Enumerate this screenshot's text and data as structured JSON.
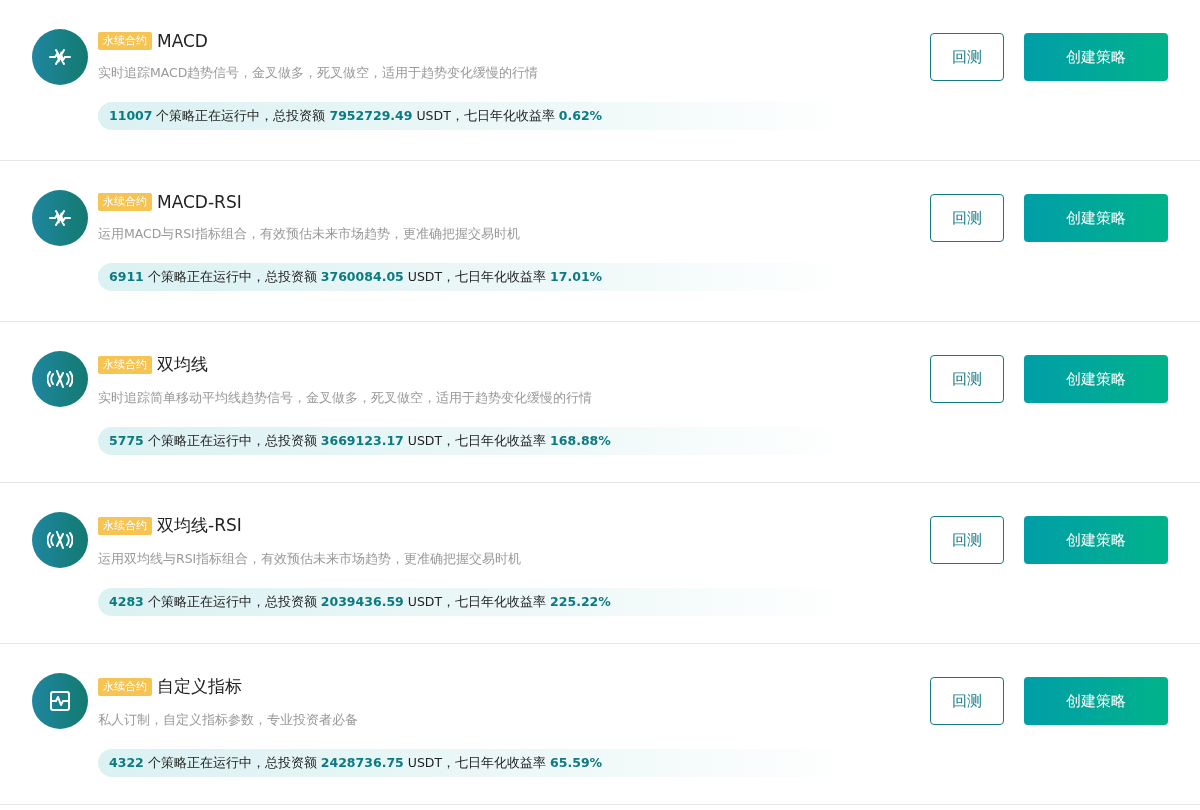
{
  "strategies": [
    {
      "kind": "signal",
      "tag": "永续合约",
      "title": "MACD",
      "description": "实时追踪MACD趋势信号，金叉做多，死叉做空，适用于趋势变化缓慢的行情",
      "stats": "**11007** 个策略正在运行中，总投资额 **7952729.49** USDT，七日年化收益率 **0.62%**",
      "backtest": "回测",
      "create": "创建策略"
    },
    {
      "kind": "signal",
      "tag": "永续合约",
      "title": "MACD-RSI",
      "description": "运用MACD与RSI指标组合，有效预估未来市场趋势，更准确把握交易时机",
      "stats": "**6911** 个策略正在运行中，总投资额 **3760084.05** USDT，七日年化收益率 **17.01%**",
      "backtest": "回测",
      "create": "创建策略"
    },
    {
      "kind": "wave",
      "tag": "永续合约",
      "title": "双均线",
      "description": "实时追踪简单移动平均线趋势信号，金叉做多，死叉做空，适用于趋势变化缓慢的行情",
      "stats": "**5775** 个策略正在运行中，总投资额 **3669123.17** USDT，七日年化收益率 **168.88%**",
      "backtest": "回测",
      "create": "创建策略"
    },
    {
      "kind": "wave",
      "tag": "永续合约",
      "title": "双均线-RSI",
      "description": "运用双均线与RSI指标组合，有效预估未来市场趋势，更准确把握交易时机",
      "stats": "**4283** 个策略正在运行中，总投资额 **2039436.59** USDT，七日年化收益率 **225.22%**",
      "backtest": "回测",
      "create": "创建策略"
    },
    {
      "kind": "chart",
      "tag": "永续合约",
      "title": "自定义指标",
      "description": "私人订制，自定义指标参数，专业投资者必备",
      "stats": "**4322** 个策略正在运行中，总投资额 **2428736.75** USDT，七日年化收益率 **65.59%**",
      "backtest": "回测",
      "create": "创建策略"
    }
  ]
}
